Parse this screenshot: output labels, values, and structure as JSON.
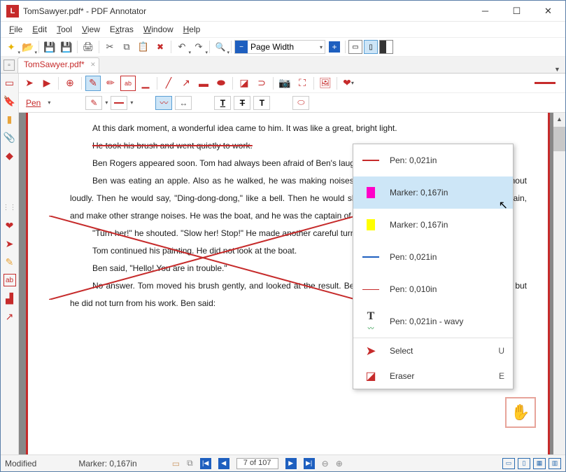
{
  "title": "TomSawyer.pdf* - PDF Annotator",
  "menu": {
    "file": "File",
    "edit": "Edit",
    "tool": "Tool",
    "view": "View",
    "extras": "Extras",
    "window": "Window",
    "help": "Help"
  },
  "zoom_sel": "Page Width",
  "tab": {
    "name": "TomSawyer.pdf*"
  },
  "pen_label": "Pen",
  "doc_lines": [
    "At this dark moment, a wonderful idea came to him. It was like a great, bright light.",
    "He took his brush and went quietly to work.",
    "Ben Rogers appeared soon. Tom had always been afraid of Ben's laugh.",
    "Ben was eating an apple. Also as he walked, he was making noises like those of a big riverboat. He would shout loudly. Then he would say, \"Ding-dong-dong,\" like a bell. Then he would shout again, and say, \"Ding-dong-dong,\" again, and make other strange noises. He was the boat, and he was the captain of the boat, and the boat bell.",
    "\"Turn her!\" he shouted. \"Slow her! Stop!\" He made another careful turn, came close beside Tom, and stopped.",
    "Tom continued his painting. He did not look at the boat.",
    "Ben said, \"Hello! You are in trouble.\"",
    "No answer. Tom moved his brush gently, and looked at the result. Ben came nearer. Tom wished for the apple, but he did not turn from his work. Ben said:"
  ],
  "popup": [
    {
      "label": "Pen: 0,021in",
      "swatch_type": "line",
      "color": "#c62b2b",
      "h": 2
    },
    {
      "label": "Marker: 0,167in",
      "swatch_type": "block",
      "color": "#ff00c8",
      "sel": true
    },
    {
      "label": "Marker: 0,167in",
      "swatch_type": "block",
      "color": "#ffff00"
    },
    {
      "label": "Pen: 0,021in",
      "swatch_type": "line",
      "color": "#1e5fbf",
      "h": 2
    },
    {
      "label": "Pen: 0,010in",
      "swatch_type": "line",
      "color": "#c62b2b",
      "h": 1
    },
    {
      "label": "Pen: 0,021in - wavy",
      "swatch_type": "text",
      "glyph": "T"
    }
  ],
  "popup2": [
    {
      "label": "Select",
      "short": "U",
      "icon": "cursor"
    },
    {
      "label": "Eraser",
      "short": "E",
      "icon": "eraser"
    }
  ],
  "status": {
    "mod": "Modified",
    "tool": "Marker: 0,167in",
    "page": "7 of 107"
  }
}
